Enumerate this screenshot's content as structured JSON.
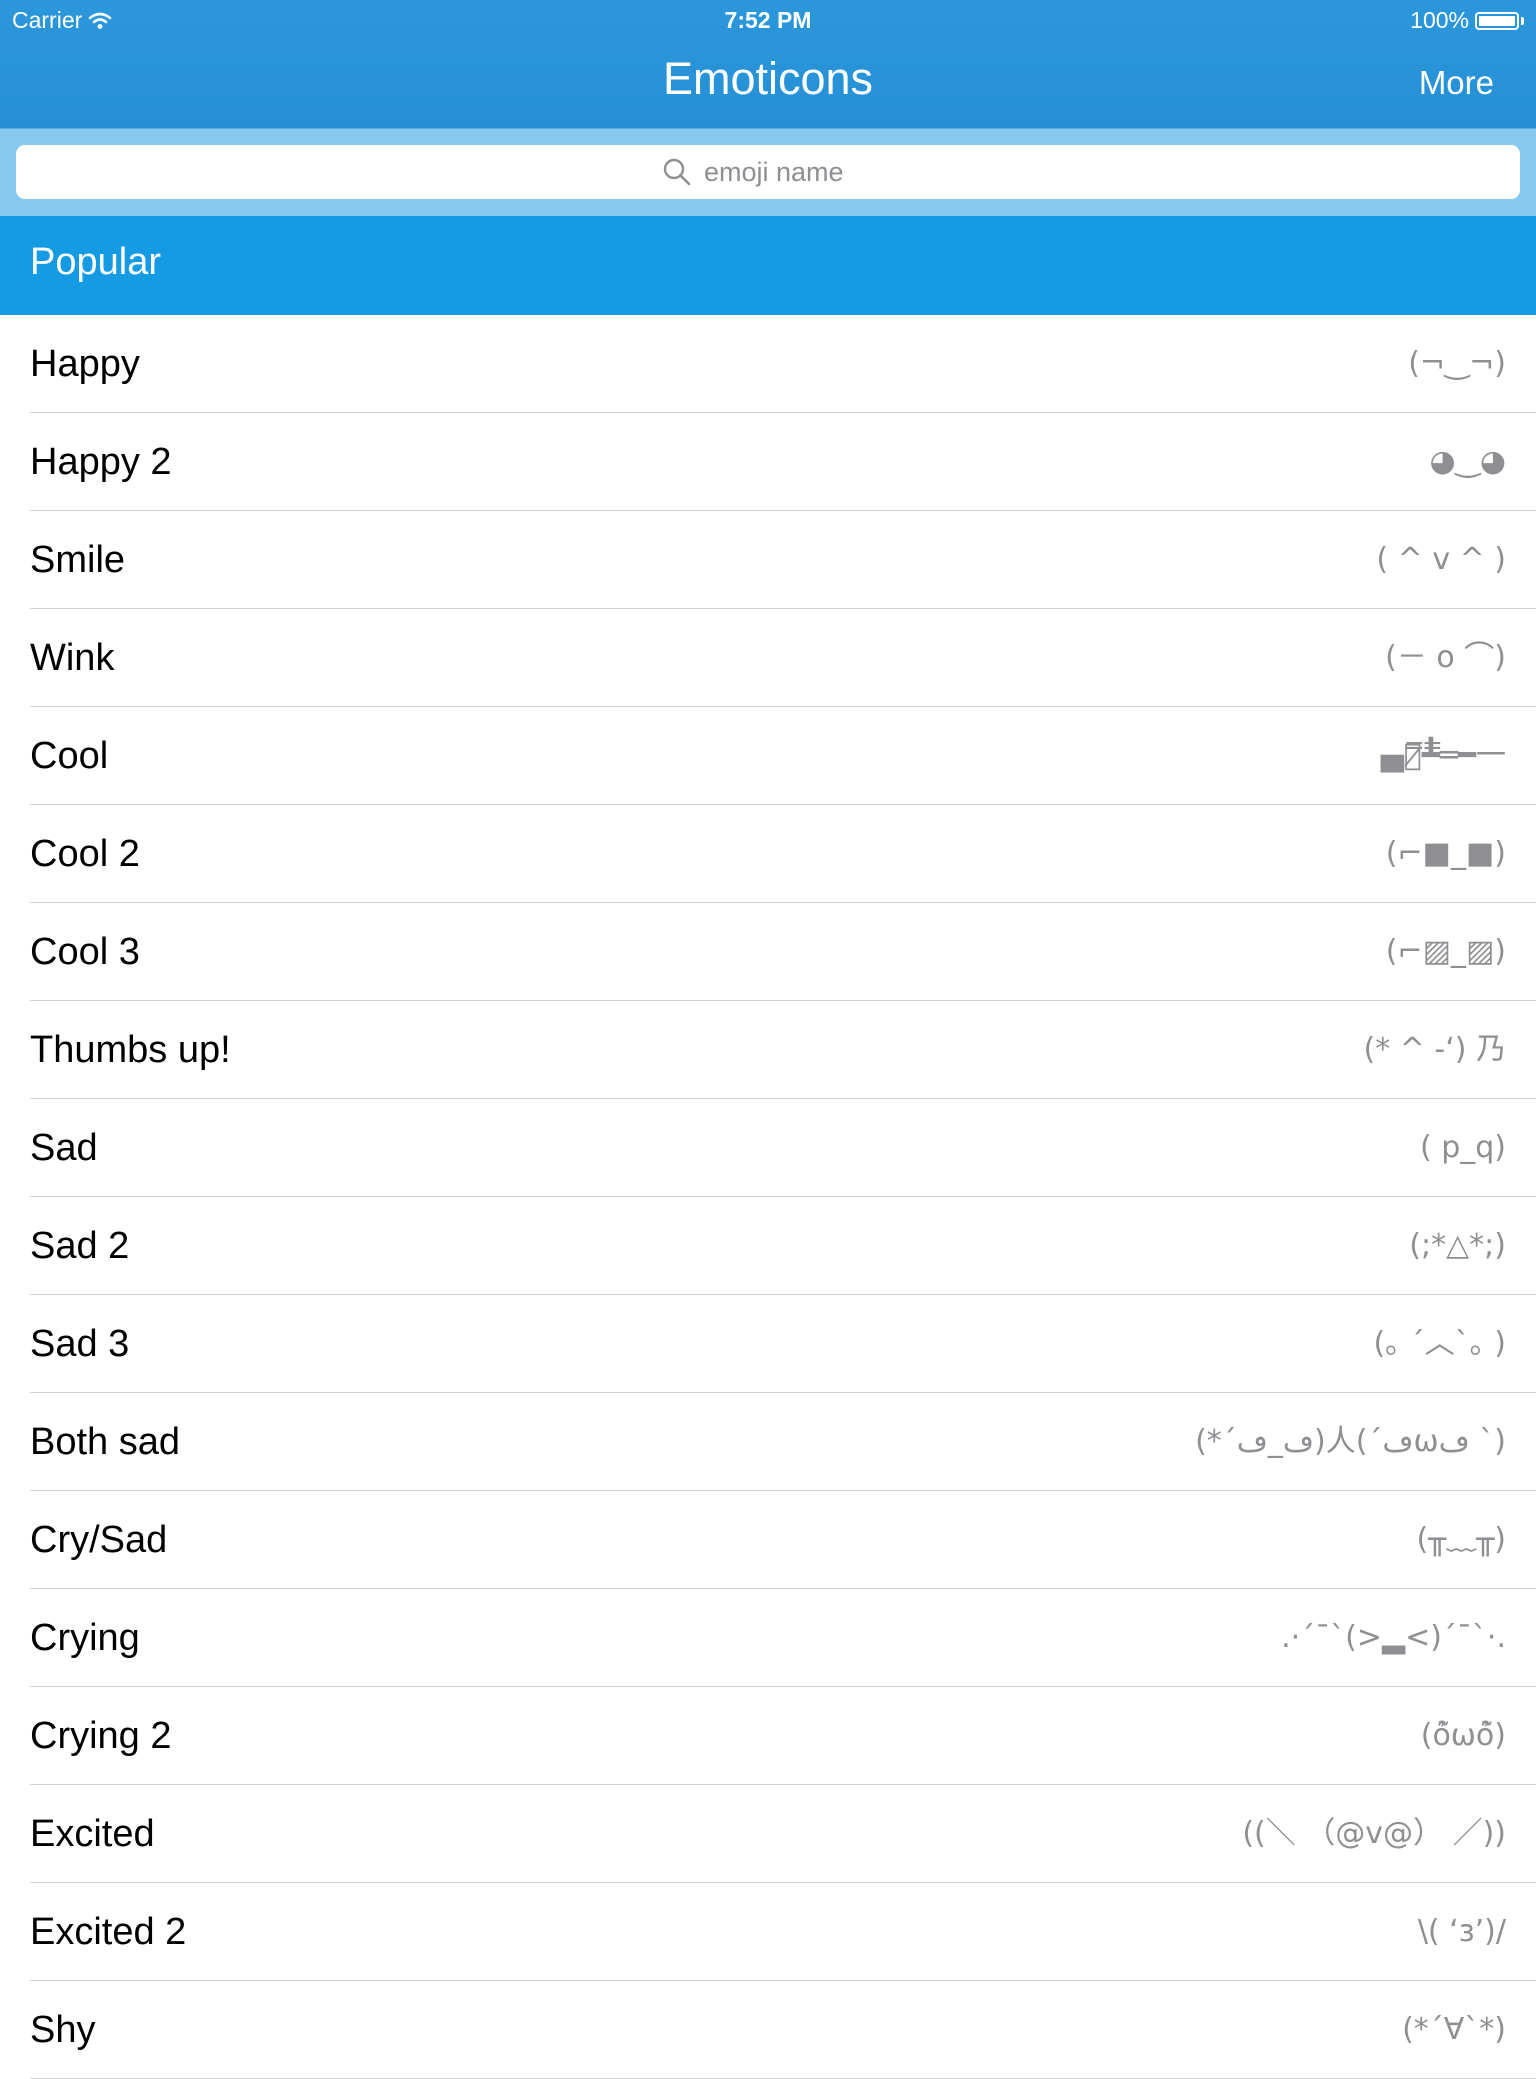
{
  "status_bar": {
    "carrier": "Carrier",
    "time": "7:52 PM",
    "battery": "100%",
    "battery_level": 1.0
  },
  "nav": {
    "title": "Emoticons",
    "more_label": "More"
  },
  "search": {
    "placeholder": "emoji name",
    "value": "",
    "icon": "search-icon"
  },
  "section": {
    "title": "Popular"
  },
  "colors": {
    "header": "#2590d6",
    "section": "#159be3",
    "search_bar": "#86c8ee",
    "emoticon_text": "#8e8e93"
  },
  "rows": [
    {
      "name": "Happy",
      "emoticon": "(¬‿¬)"
    },
    {
      "name": "Happy 2",
      "emoticon": "◕‿◕"
    },
    {
      "name": "Smile",
      "emoticon": "( ^ v ^ )"
    },
    {
      "name": "Wink",
      "emoticon": "(－ o ⌒)"
    },
    {
      "name": "Cool",
      "emoticon": "▄︻̷̿┻̿═━一"
    },
    {
      "name": "Cool 2",
      "emoticon": "(⌐■_■)"
    },
    {
      "name": "Cool 3",
      "emoticon": "(⌐▨_▨)"
    },
    {
      "name": "Thumbs up!",
      "emoticon": "(* ^ -ʻ) 乃"
    },
    {
      "name": "Sad",
      "emoticon": "( p_q)"
    },
    {
      "name": "Sad 2",
      "emoticon": "(;*△*;)"
    },
    {
      "name": "Sad 3",
      "emoticon": "(｡ ´︿`｡ )"
    },
    {
      "name": "Both sad",
      "emoticon": "(*´ڡ_ڡ)人(´ڡωڡ `)"
    },
    {
      "name": "Cry/Sad",
      "emoticon": "(╥﹏╥)"
    },
    {
      "name": "Crying",
      "emoticon": ".·´¯`(>▂<)´¯`·."
    },
    {
      "name": "Crying 2",
      "emoticon": "(ỏ̃ωỏ̃)"
    },
    {
      "name": "Excited",
      "emoticon": "((＼ （@v@） ／))"
    },
    {
      "name": "Excited 2",
      "emoticon": "\\( ‘з’)/"
    },
    {
      "name": "Shy",
      "emoticon": "(*´∀`*)"
    }
  ]
}
